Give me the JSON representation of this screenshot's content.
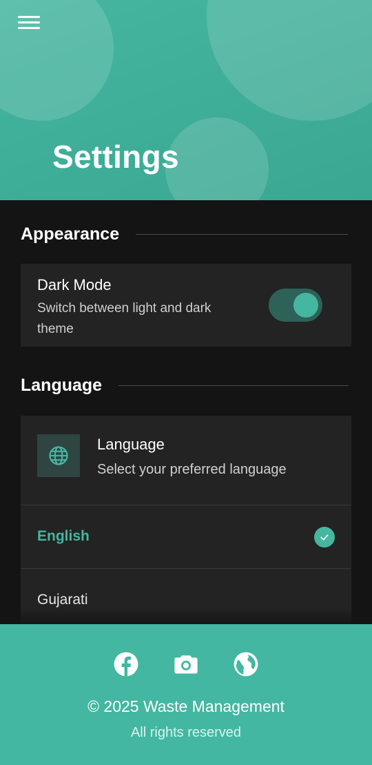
{
  "header": {
    "title": "Settings",
    "menu_icon": "hamburger-menu-icon"
  },
  "appearance": {
    "section_title": "Appearance",
    "dark_mode": {
      "title": "Dark Mode",
      "description": "Switch between light and dark theme",
      "enabled": true
    }
  },
  "language": {
    "section_title": "Language",
    "card_title": "Language",
    "card_description": "Select your preferred language",
    "icon": "globe-icon",
    "options": [
      {
        "label": "English",
        "selected": true
      },
      {
        "label": "Gujarati",
        "selected": false
      }
    ]
  },
  "footer": {
    "social_icons": [
      "facebook-icon",
      "camera-icon",
      "globe-icon"
    ],
    "copyright": "© 2025 Waste Management",
    "rights": "All rights reserved"
  },
  "colors": {
    "accent": "#45b6a0",
    "background": "#141414",
    "card": "#232323",
    "footer": "#43b7a1"
  }
}
